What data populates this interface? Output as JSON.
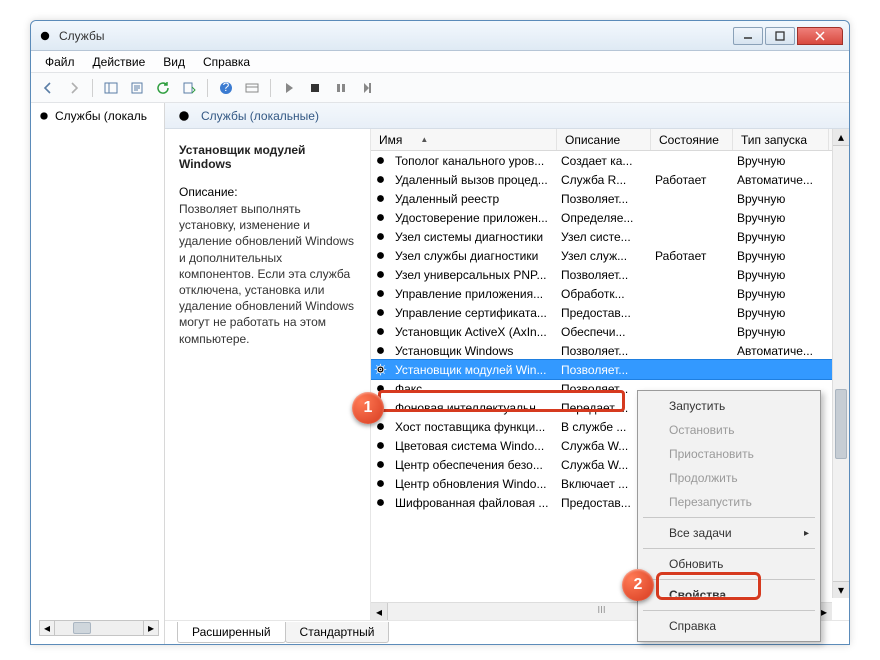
{
  "window": {
    "title": "Службы"
  },
  "menu": {
    "file": "Файл",
    "action": "Действие",
    "view": "Вид",
    "help": "Справка"
  },
  "tree": {
    "node": "Службы (локаль"
  },
  "listHeader": "Службы (локальные)",
  "detail": {
    "title": "Установщик модулей Windows",
    "descLabel": "Описание:",
    "desc": "Позволяет выполнять установку, изменение и удаление обновлений Windows и дополнительных компонентов. Если эта служба отключена, установка или удаление обновлений Windows могут не работать на этом компьютере."
  },
  "columns": {
    "name": "Имя",
    "desc": "Описание",
    "state": "Состояние",
    "start": "Тип запуска"
  },
  "rows": [
    {
      "name": "Тополог канального уров...",
      "desc": "Создает ка...",
      "state": "",
      "start": "Вручную"
    },
    {
      "name": "Удаленный вызов процед...",
      "desc": "Служба R...",
      "state": "Работает",
      "start": "Автоматиче..."
    },
    {
      "name": "Удаленный реестр",
      "desc": "Позволяет...",
      "state": "",
      "start": "Вручную"
    },
    {
      "name": "Удостоверение приложен...",
      "desc": "Определяе...",
      "state": "",
      "start": "Вручную"
    },
    {
      "name": "Узел системы диагностики",
      "desc": "Узел систе...",
      "state": "",
      "start": "Вручную"
    },
    {
      "name": "Узел службы диагностики",
      "desc": "Узел служ...",
      "state": "Работает",
      "start": "Вручную"
    },
    {
      "name": "Узел универсальных PNP...",
      "desc": "Позволяет...",
      "state": "",
      "start": "Вручную"
    },
    {
      "name": "Управление приложения...",
      "desc": "Обработк...",
      "state": "",
      "start": "Вручную"
    },
    {
      "name": "Управление сертификата...",
      "desc": "Предостав...",
      "state": "",
      "start": "Вручную"
    },
    {
      "name": "Установщик ActiveX (AxIn...",
      "desc": "Обеспечи...",
      "state": "",
      "start": "Вручную"
    },
    {
      "name": "Установщик Windows",
      "desc": "Позволяет...",
      "state": "",
      "start": "Автоматиче..."
    },
    {
      "name": "Установщик модулей Win...",
      "desc": "Позволяет...",
      "state": "",
      "start": "",
      "selected": true
    },
    {
      "name": "Факс",
      "desc": "Позволяет...",
      "state": "",
      "start": ""
    },
    {
      "name": "Фоновая интеллектуальн...",
      "desc": "Передает ...",
      "state": "",
      "start": ""
    },
    {
      "name": "Хост поставщика функци...",
      "desc": "В службе ...",
      "state": "",
      "start": ""
    },
    {
      "name": "Цветовая система Windo...",
      "desc": "Служба W...",
      "state": "",
      "start": ""
    },
    {
      "name": "Центр обеспечения безо...",
      "desc": "Служба W...",
      "state": "",
      "start": ""
    },
    {
      "name": "Центр обновления Windo...",
      "desc": "Включает ...",
      "state": "",
      "start": ""
    },
    {
      "name": "Шифрованная файловая ...",
      "desc": "Предостав...",
      "state": "",
      "start": ""
    }
  ],
  "hscrollCaption": "III",
  "tabs": {
    "extended": "Расширенный",
    "standard": "Стандартный"
  },
  "ctx": {
    "start": "Запустить",
    "stop": "Остановить",
    "pause": "Приостановить",
    "resume": "Продолжить",
    "restart": "Перезапустить",
    "allTasks": "Все задачи",
    "refresh": "Обновить",
    "properties": "Свойства",
    "helpItem": "Справка"
  },
  "callouts": {
    "one": "1",
    "two": "2"
  }
}
